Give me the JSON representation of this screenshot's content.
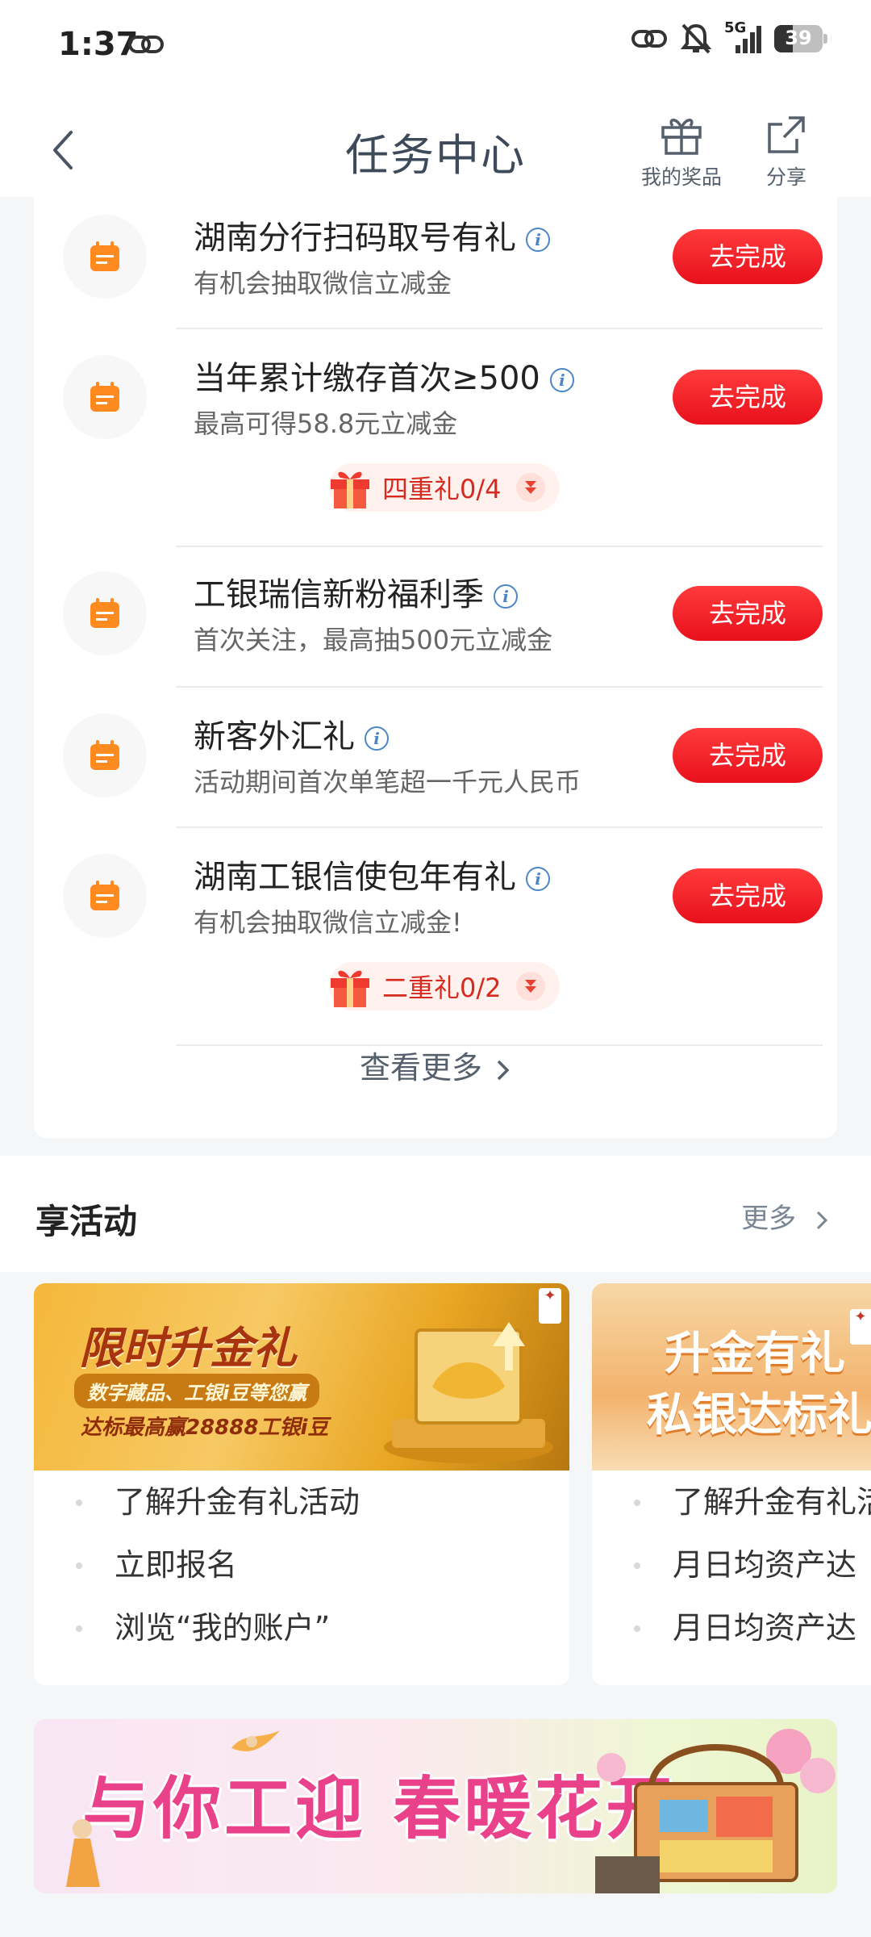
{
  "status_bar": {
    "time": "1:37",
    "battery": "39",
    "network": "5G"
  },
  "header": {
    "title": "任务中心",
    "prizes_label": "我的奖品",
    "share_label": "分享"
  },
  "tasks": [
    {
      "name": "湖南分行扫码取号有礼",
      "desc": "有机会抽取微信立减金",
      "button": "去完成"
    },
    {
      "name": "当年累计缴存首次≥500",
      "desc": "最高可得58.8元立减金",
      "button": "去完成",
      "reward": "四重礼0/4"
    },
    {
      "name": "工银瑞信新粉福利季",
      "desc": "首次关注，最高抽500元立减金",
      "button": "去完成"
    },
    {
      "name": "新客外汇礼",
      "desc": "活动期间首次单笔超一千元人民币",
      "button": "去完成"
    },
    {
      "name": "湖南工银信使包年有礼",
      "desc": "有机会抽取微信立减金!",
      "button": "去完成",
      "reward": "二重礼0/2"
    }
  ],
  "view_more": "查看更多",
  "activities": {
    "title": "享活动",
    "more": "更多",
    "cards": [
      {
        "banner_title": "限时升金礼",
        "banner_sub1": "数字藏品、工银i豆等您赢",
        "banner_sub2": "达标最高赢28888工银i豆",
        "items": [
          "了解升金有礼活动",
          "立即报名",
          "浏览“我的账户”"
        ]
      },
      {
        "banner_title": "升金有礼",
        "banner_title2": "私银达标礼",
        "items": [
          "了解升金有礼活",
          "月日均资产达",
          "月日均资产达"
        ]
      }
    ]
  },
  "bottom_banner": {
    "text": "与你工迎 春暖花开"
  },
  "colors": {
    "accent_red": "#e8101c",
    "icon_orange": "#ff8a1f",
    "title_blue_gray": "#3d4a5a"
  }
}
